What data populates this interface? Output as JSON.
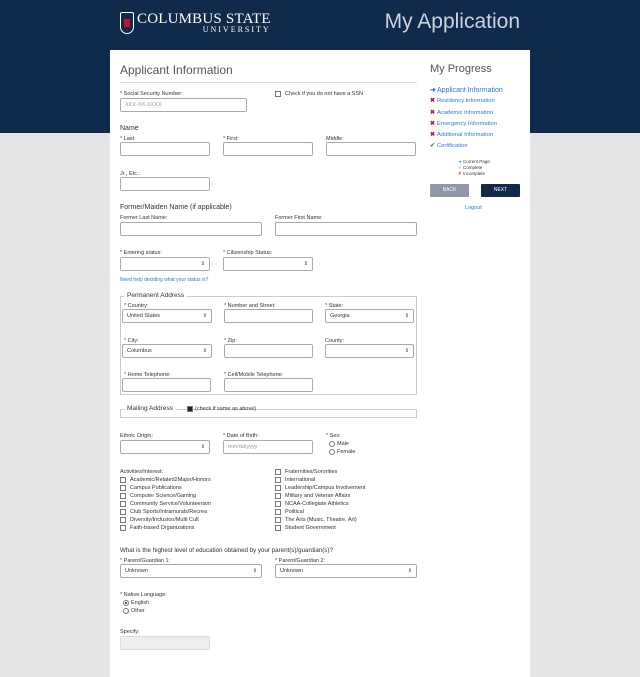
{
  "header": {
    "logo_line1": "COLUMBUS STATE",
    "logo_line2": "UNIVERSITY",
    "app_title": "My Application"
  },
  "form": {
    "title": "Applicant Information",
    "ssn": {
      "label": "Social Security Number:",
      "placeholder": "XXX-XX-XXXX"
    },
    "no_ssn_label": "Check if you do not have a SSN",
    "name_section": "Name",
    "last_label": "Last:",
    "first_label": "First:",
    "middle_label": "Middle:",
    "jr_label": "Jr., Etc.:",
    "former_section": "Former/Maiden Name (if applicable)",
    "former_last_label": "Former Last Name:",
    "former_first_label": "Former First Name:",
    "entering_label": "Entering status:",
    "citizenship_label": "Citizenship Status:",
    "help_link": "Need help deciding what your status is?",
    "permanent_address": {
      "legend": "Permanent Address",
      "country_label": "Country:",
      "country_value": "United States",
      "street_label": "Number and Street:",
      "state_label": "State:",
      "state_value": "Georgia",
      "city_label": "City:",
      "city_value": "Columbus",
      "zip_label": "Zip:",
      "county_label": "County:",
      "home_tel_label": "Home Telephone:",
      "cell_tel_label": "Cell/Mobile Telephone:"
    },
    "mailing": {
      "legend": "Mailing Address",
      "same_label": "(check if same as above)"
    },
    "ethnic_label": "Ethnic Origin:",
    "dob_label": "Date of Birth:",
    "dob_placeholder": "mm/dd/yyyy",
    "sex_label": "Sex:",
    "sex_options": [
      "Male",
      "Female"
    ],
    "activities_label": "Activities/Interest:",
    "activities_left": [
      "Academic/Related2Major/Honors",
      "Campus Publications",
      "Computer Science/Gaming",
      "Community Service/Volunteerism",
      "Club Sports/Intramurals/Recrea",
      "Diversity/Inclusion/Multi Cult",
      "Faith-based Organizations"
    ],
    "activities_right": [
      "Fraternities/Sororities",
      "International",
      "Leadership/Campus Involvement",
      "Military and Veteran Affairs",
      "NCAA-Collegiate Athletics",
      "Political",
      "The Arts (Music, Theatre, Art)",
      "Student Government"
    ],
    "parent_question": "What is the highest level of education obtained by your parent(s)/guardian(s)?",
    "parent1_label": "Parent/Guardian 1:",
    "parent1_value": "Unknown",
    "parent2_label": "Parent/Guardian 2:",
    "parent2_value": "Unknown",
    "language_label": "Native Language:",
    "language_options": [
      "English",
      "Other"
    ],
    "specify_label": "Specify:"
  },
  "progress": {
    "title": "My Progress",
    "steps": [
      {
        "label": "Applicant Information",
        "state": "current"
      },
      {
        "label": "Residency Information",
        "state": "incomplete"
      },
      {
        "label": "Academic Information",
        "state": "incomplete"
      },
      {
        "label": "Emergency Information",
        "state": "incomplete"
      },
      {
        "label": "Additional Information",
        "state": "incomplete"
      },
      {
        "label": "Certification",
        "state": "complete"
      }
    ],
    "legend": [
      "Current Page",
      "Complete",
      "Incomplete"
    ],
    "back_label": "BACK",
    "next_label": "NEXT",
    "logout_label": "Logout"
  },
  "colors": {
    "navy": "#0f2a4a",
    "accent_red": "#c8102e",
    "link_blue": "#2a7ad8",
    "complete_green": "#2e8b3a"
  }
}
